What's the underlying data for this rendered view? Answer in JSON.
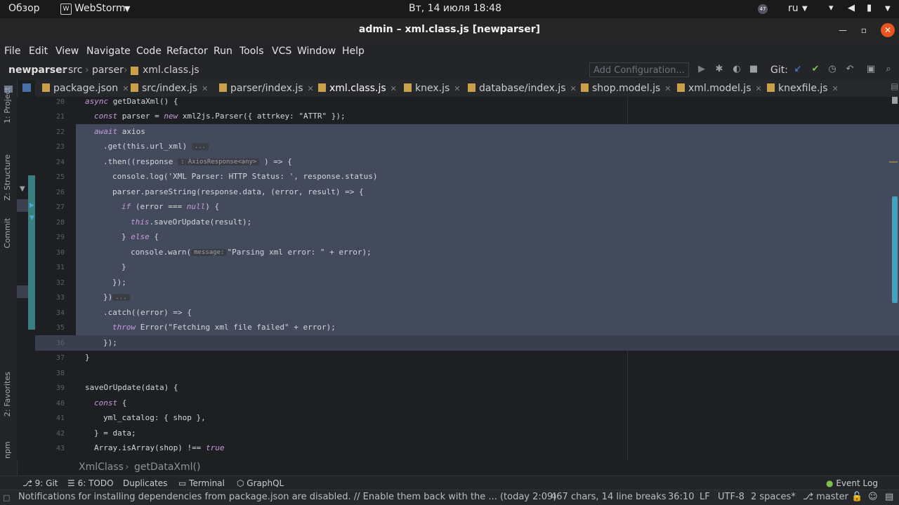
{
  "topbar": {
    "activities": "Обзор",
    "app_name": "WebStorm",
    "clock": "Вт, 14 июля  18:48",
    "keyboard_layout": "ru",
    "tray_badge": "47"
  },
  "window": {
    "title": "admin – xml.class.js [newparser]"
  },
  "menu": [
    "File",
    "Edit",
    "View",
    "Navigate",
    "Code",
    "Refactor",
    "Run",
    "Tools",
    "VCS",
    "Window",
    "Help"
  ],
  "breadcrumb_nav": {
    "project": "newparser",
    "dir1": "src",
    "dir2": "parser",
    "file": "xml.class.js"
  },
  "toolbar": {
    "add_configuration": "Add Configuration...",
    "git_label": "Git:"
  },
  "tabs": [
    {
      "label": "package.json"
    },
    {
      "label": "src/index.js"
    },
    {
      "label": "parser/index.js"
    },
    {
      "label": "xml.class.js"
    },
    {
      "label": "knex.js"
    },
    {
      "label": "database/index.js"
    },
    {
      "label": "shop.model.js"
    },
    {
      "label": "xml.model.js"
    },
    {
      "label": "knexfile.js"
    }
  ],
  "side_panels": {
    "project": "1: Project",
    "structure": "Z: Structure",
    "commit": "Commit",
    "favorites": "2: Favorites",
    "npm": "npm"
  },
  "code": {
    "line_numbers": [
      "20",
      "21",
      "22",
      "23",
      "24",
      "25",
      "26",
      "27",
      "28",
      "29",
      "30",
      "31",
      "32",
      "33",
      "34",
      "35",
      "36",
      "37",
      "38",
      "39",
      "40",
      "41",
      "42",
      "43"
    ],
    "l20_kw": "async",
    "l20_rest": " getDataXml() {",
    "l21_kw": "const",
    "l21_rest": " parser = ",
    "l21_kw2": "new",
    "l21_rest2": " xml2js.Parser({ attrkey: \"ATTR\" });",
    "l22_kw": "await",
    "l22_rest": " axios",
    "l23": ".get(this.url_xml)",
    "l23_hint": "...",
    "l24_a": ".then((response",
    "l24_hint": ": AxiosResponse<any>",
    "l24_b": ") => {",
    "l25": "console.log('XML Parser: HTTP Status: ', response.status)",
    "l26": "parser.parseString(response.data, (error, result) => {",
    "l27_kw": "if",
    "l27_a": " (error === ",
    "l27_null": "null",
    "l27_b": ") {",
    "l28_this": "this",
    "l28_rest": ".saveOrUpdate(result);",
    "l29_a": "} ",
    "l29_kw": "else",
    "l29_b": " {",
    "l30_a": "console.warn(",
    "l30_hint": "message:",
    "l30_b": "\"Parsing xml error: \" + error);",
    "l31": "}",
    "l32": "});",
    "l33": "})",
    "l33_hint": "...",
    "l34": ".catch((error) => {",
    "l35_kw": "throw",
    "l35_rest": " Error(\"Fetching xml file failed\" + error);",
    "l36": "});",
    "l37": "}",
    "l39": "saveOrUpdate(data) {",
    "l40_kw": "const",
    "l40_rest": " {",
    "l41": "yml_catalog: { shop },",
    "l42": "} = data;",
    "l43_a": "Array.isArray(shop) !== ",
    "l43_kw": "true"
  },
  "crumbs": {
    "class": "XmlClass",
    "method": "getDataXml()"
  },
  "bottom_tools": [
    "9: Git",
    "6: TODO",
    "Duplicates",
    "Terminal",
    "GraphQL",
    "Event Log"
  ],
  "status": {
    "message": "Notifications for installing dependencies from package.json are disabled. // Enable them back with the ... (today 2:09)",
    "selection": "467 chars, 14 line breaks",
    "position": "36:10",
    "line_sep": "LF",
    "encoding": "UTF-8",
    "indent": "2 spaces*",
    "branch": "master"
  },
  "colors": {
    "accent": "#4aa8c9",
    "selection": "#434a5c",
    "close_button": "#e95420",
    "git_check": "#7ec04c"
  }
}
